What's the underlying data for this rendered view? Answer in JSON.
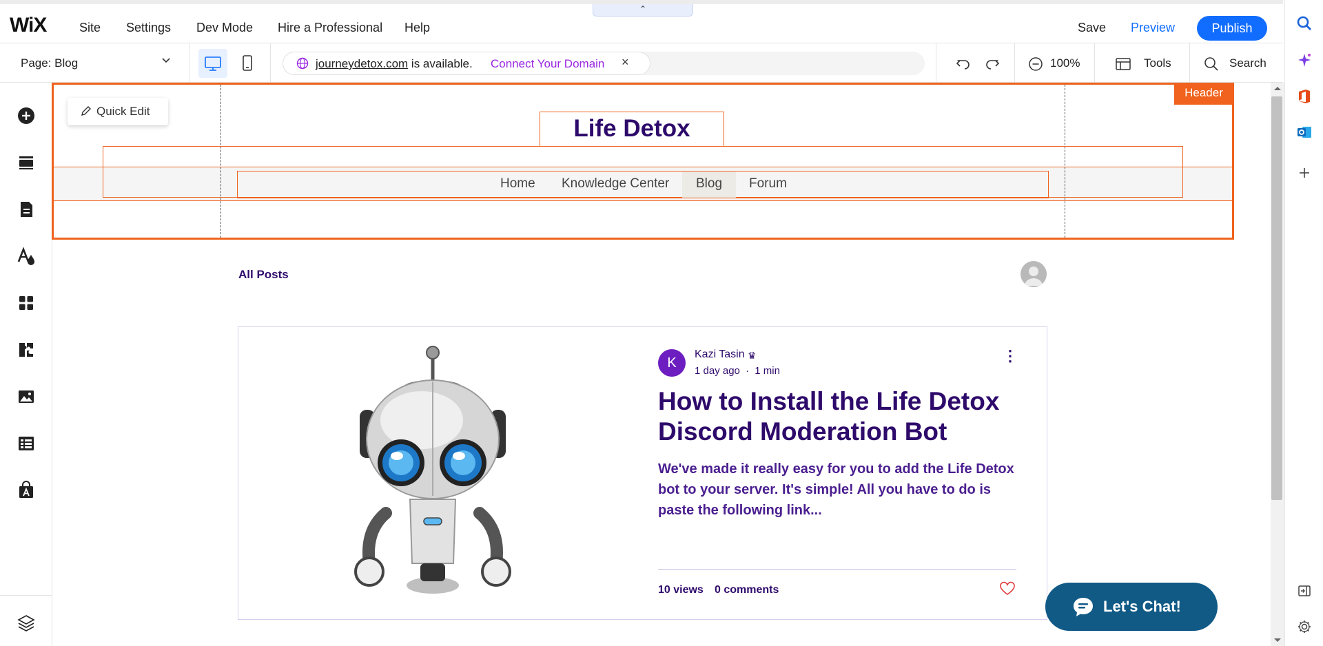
{
  "app": {
    "logo": "WiX"
  },
  "topbar": {
    "menu": [
      "Site",
      "Settings",
      "Dev Mode",
      "Hire a Professional",
      "Help"
    ],
    "collapse_icon": "chevron-up-icon",
    "save_label": "Save",
    "preview_label": "Preview",
    "publish_label": "Publish"
  },
  "toolbar": {
    "page_label": "Page: Blog",
    "domain_name": "journeydetox.com",
    "domain_text": " is available.",
    "connect_label": "Connect Your Domain",
    "close_label": "×",
    "zoom": "100%",
    "tools_label": "Tools",
    "search_label": "Search"
  },
  "editor": {
    "quick_edit_label": "Quick Edit",
    "header_tag": "Header"
  },
  "site": {
    "title": "Life Detox",
    "nav": [
      "Home",
      "Knowledge Center",
      "Blog",
      "Forum"
    ],
    "active_nav": "Blog"
  },
  "blog": {
    "section_title": "All Posts",
    "post": {
      "author_initial": "K",
      "author": "Kazi Tasin",
      "time": "1 day ago",
      "separator": "·",
      "read_time": "1 min",
      "title": "How to Install the Life Detox Discord Moderation Bot",
      "excerpt": "We've made it really easy for you to add the Life Detox bot to your server. It's simple! All you have to do is paste the following link...",
      "views": "10 views",
      "comments": "0 comments"
    }
  },
  "chat": {
    "label": "Let's Chat!"
  },
  "colors": {
    "accent": "#116dff",
    "selection": "#f0621d",
    "site_text": "#2e0a6b",
    "connect": "#9a26e0",
    "chat_bg": "#115a86"
  }
}
